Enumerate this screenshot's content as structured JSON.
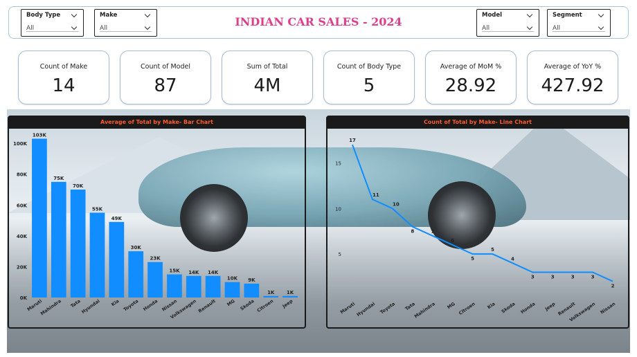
{
  "title": "INDIAN CAR SALES - 2024",
  "slicers": [
    {
      "label": "Body Type",
      "value": "All"
    },
    {
      "label": "Make",
      "value": "All"
    },
    {
      "label": "Model",
      "value": "All"
    },
    {
      "label": "Segment",
      "value": "All"
    }
  ],
  "kpis": [
    {
      "label": "Count of Make",
      "value": "14"
    },
    {
      "label": "Count of Model",
      "value": "87"
    },
    {
      "label": "Sum of Total",
      "value": "4M"
    },
    {
      "label": "Count of Body Type",
      "value": "5"
    },
    {
      "label": "Average of MoM %",
      "value": "28.92"
    },
    {
      "label": "Average of YoY %",
      "value": "427.92"
    }
  ],
  "colors": {
    "bar": "#118dff",
    "line": "#118dff",
    "title": "#de3f8c",
    "chart_title": "#ff5a2b"
  },
  "chart_data": [
    {
      "type": "bar",
      "title": "Average of Total by Make- Bar Chart",
      "categories": [
        "Maruti",
        "Mahindra",
        "Tata",
        "Hyundai",
        "Kia",
        "Toyota",
        "Honda",
        "Nissan",
        "Volkswagen",
        "Renault",
        "MG",
        "Skoda",
        "Citroen",
        "Jeep"
      ],
      "values": [
        103,
        75,
        70,
        55,
        49,
        30,
        23,
        15,
        14,
        14,
        10,
        9,
        1,
        1
      ],
      "data_labels": [
        "103K",
        "75K",
        "70K",
        "55K",
        "49K",
        "30K",
        "23K",
        "15K",
        "14K",
        "14K",
        "10K",
        "9K",
        "1K",
        "1K"
      ],
      "yticks": [
        "0K",
        "20K",
        "40K",
        "60K",
        "80K",
        "100K"
      ],
      "ylim": [
        0,
        105
      ],
      "grid": false
    },
    {
      "type": "line",
      "title": "Count of Total by Make- Line Chart",
      "categories": [
        "Maruti",
        "Hyundai",
        "Toyota",
        "Tata",
        "Mahindra",
        "MG",
        "Citroen",
        "Kia",
        "Skoda",
        "Honda",
        "Jeep",
        "Renault",
        "Volkswagen",
        "Nissan"
      ],
      "values": [
        17,
        11,
        10,
        8,
        7,
        6,
        5,
        5,
        4,
        3,
        3,
        3,
        3,
        2
      ],
      "yticks": [
        "5",
        "10",
        "15"
      ],
      "ylim": [
        0,
        18
      ],
      "grid": false
    }
  ]
}
